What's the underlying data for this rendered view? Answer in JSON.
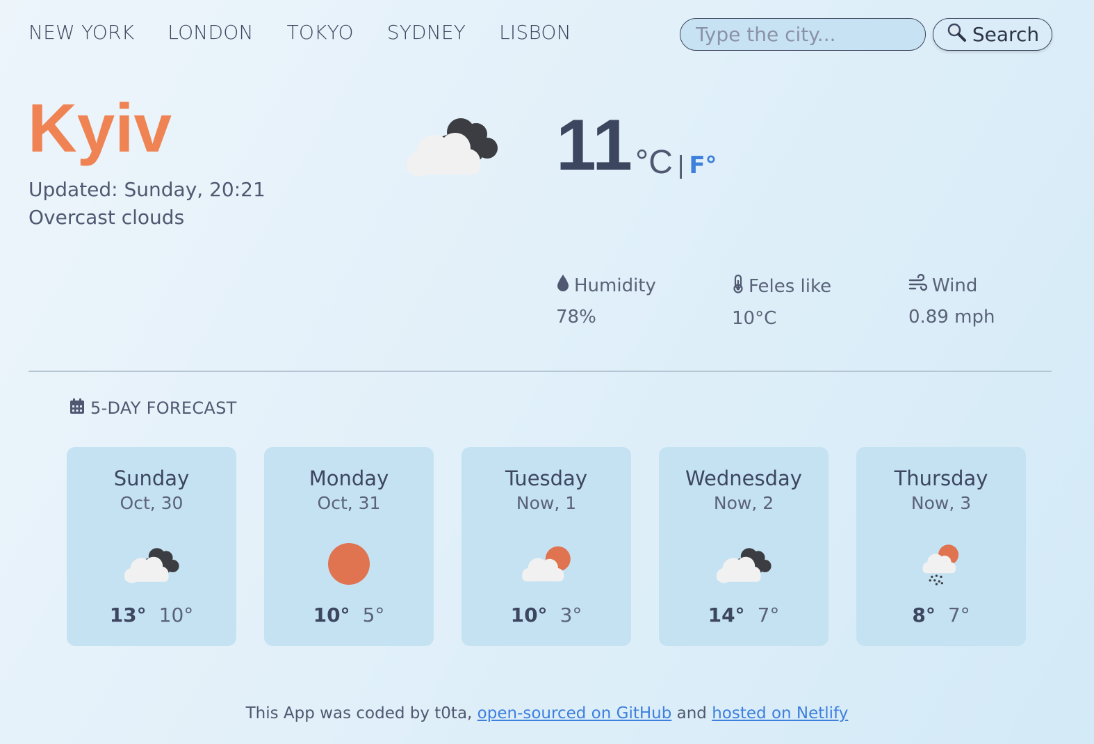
{
  "nav": {
    "cities": [
      "NEW YORK",
      "LONDON",
      "TOKYO",
      "SYDNEY",
      "LISBON"
    ]
  },
  "search": {
    "placeholder": "Type the city...",
    "button_label": "Search",
    "button_icon": "magnifier-icon"
  },
  "current": {
    "city": "Kyiv",
    "updated": "Updated: Sunday, 20:21",
    "description": "Overcast clouds",
    "icon": "overcast-clouds-icon",
    "temperature": "11",
    "unit_celsius": "°C",
    "unit_separator": "|",
    "unit_fahrenheit": "F°"
  },
  "stats": {
    "humidity": {
      "label": "Humidity",
      "value": "78%",
      "icon": "droplet-icon"
    },
    "feels_like": {
      "label": "Feles like",
      "value": "10°C",
      "icon": "thermometer-icon"
    },
    "wind": {
      "label": "Wind",
      "value": "0.89 mph",
      "icon": "wind-icon"
    }
  },
  "forecast": {
    "title": "5-DAY FORECAST",
    "icon": "calendar-icon",
    "days": [
      {
        "day": "Sunday",
        "date": "Oct, 30",
        "icon": "overcast-clouds-icon",
        "hi": "13°",
        "lo": "10°"
      },
      {
        "day": "Monday",
        "date": "Oct, 31",
        "icon": "sun-icon",
        "hi": "10°",
        "lo": "5°"
      },
      {
        "day": "Tuesday",
        "date": "Now, 1",
        "icon": "partly-cloudy-icon",
        "hi": "10°",
        "lo": "3°"
      },
      {
        "day": "Wednesday",
        "date": "Now, 2",
        "icon": "overcast-clouds-icon",
        "hi": "14°",
        "lo": "7°"
      },
      {
        "day": "Thursday",
        "date": "Now, 3",
        "icon": "rain-sun-icon",
        "hi": "8°",
        "lo": "7°"
      }
    ]
  },
  "footer": {
    "prefix": "This App was coded by t0ta, ",
    "github_link": "open-sourced on GitHub",
    "middle": " and ",
    "netlify_link": "hosted on Netlify"
  },
  "colors": {
    "accent": "#ef8354",
    "link": "#3d7fdd",
    "card_bg": "#c5e2f3",
    "text_dark": "#3d465f"
  }
}
